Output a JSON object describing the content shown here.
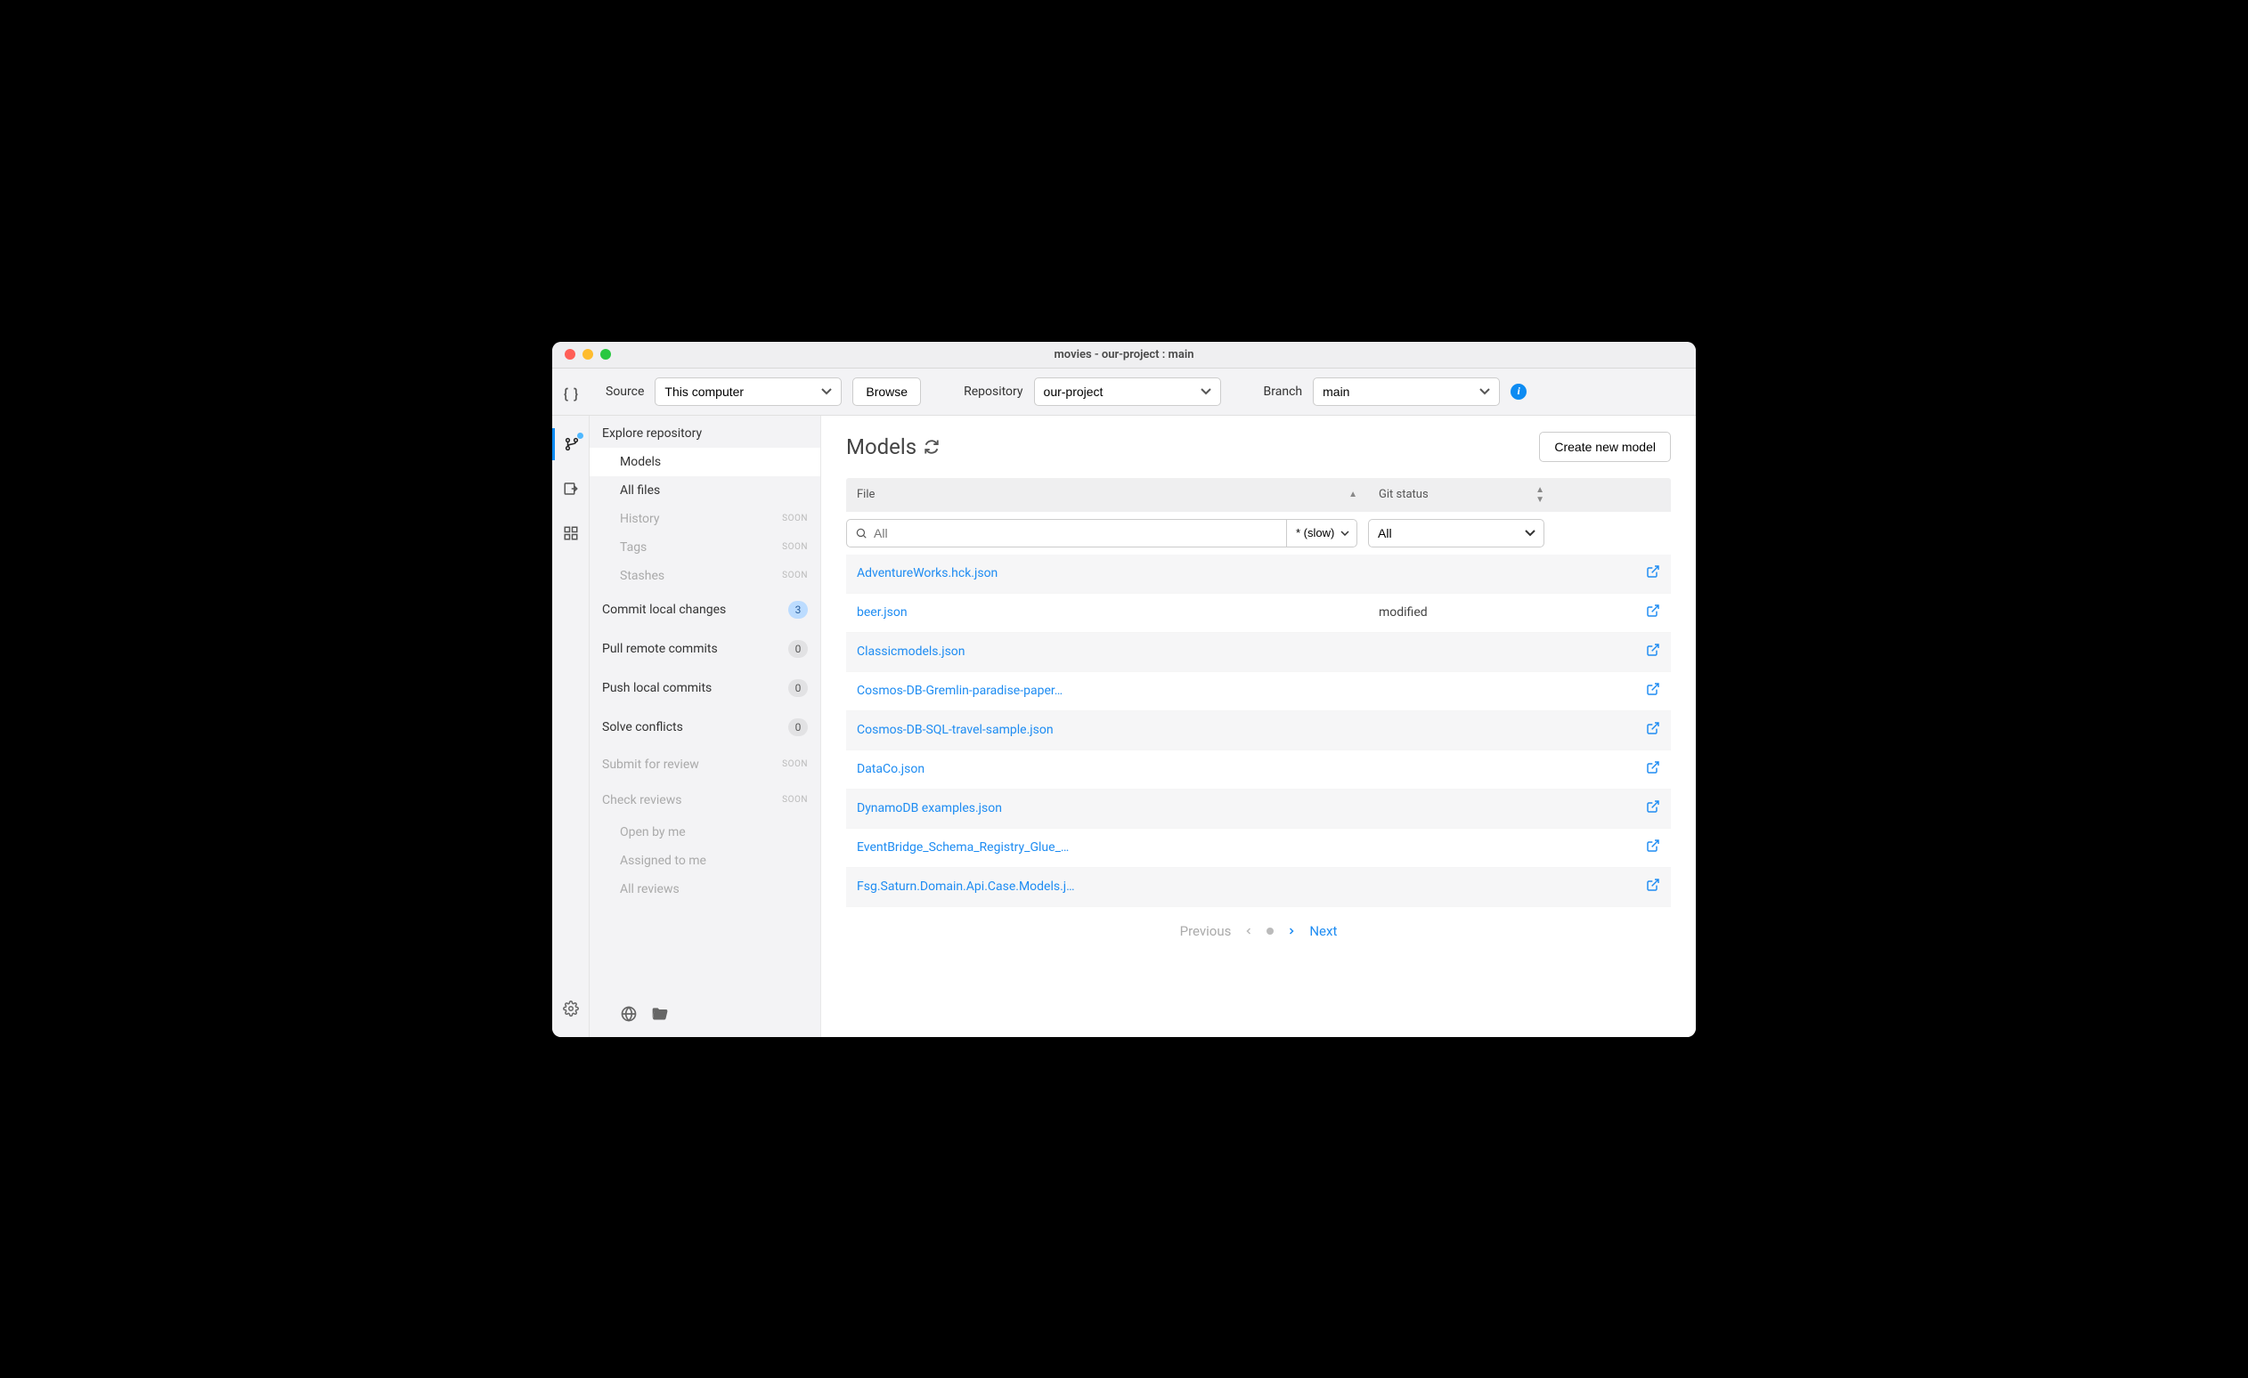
{
  "window": {
    "title": "movies - our-project : main"
  },
  "toolbar": {
    "source_label": "Source",
    "source_value": "This computer",
    "browse_label": "Browse",
    "repo_label": "Repository",
    "repo_value": "our-project",
    "branch_label": "Branch",
    "branch_value": "main"
  },
  "sidebar": {
    "explore_label": "Explore repository",
    "items": [
      {
        "label": "Models",
        "active": true
      },
      {
        "label": "All files"
      },
      {
        "label": "History",
        "soon": true
      },
      {
        "label": "Tags",
        "soon": true
      },
      {
        "label": "Stashes",
        "soon": true
      }
    ],
    "actions": [
      {
        "label": "Commit local changes",
        "count": "3",
        "blue": true
      },
      {
        "label": "Pull remote commits",
        "count": "0"
      },
      {
        "label": "Push local commits",
        "count": "0"
      },
      {
        "label": "Solve conflicts",
        "count": "0"
      },
      {
        "label": "Submit for review",
        "soon": true
      },
      {
        "label": "Check reviews",
        "soon": true
      }
    ],
    "review_sub": [
      {
        "label": "Open by me"
      },
      {
        "label": "Assigned to me"
      },
      {
        "label": "All reviews"
      }
    ],
    "soon_text": "SOON"
  },
  "main": {
    "title": "Models",
    "create_label": "Create new model",
    "columns": {
      "file": "File",
      "git": "Git status"
    },
    "search_placeholder": "All",
    "slow_label": "* (slow)",
    "git_filter_value": "All",
    "rows": [
      {
        "file": "AdventureWorks.hck.json",
        "git": ""
      },
      {
        "file": "beer.json",
        "git": "modified"
      },
      {
        "file": "Classicmodels.json",
        "git": ""
      },
      {
        "file": "Cosmos-DB-Gremlin-paradise-paper…",
        "git": ""
      },
      {
        "file": "Cosmos-DB-SQL-travel-sample.json",
        "git": ""
      },
      {
        "file": "DataCo.json",
        "git": ""
      },
      {
        "file": "DynamoDB examples.json",
        "git": ""
      },
      {
        "file": "EventBridge_Schema_Registry_Glue_…",
        "git": ""
      },
      {
        "file": "Fsg.Saturn.Domain.Api.Case.Models.j…",
        "git": ""
      }
    ],
    "pager": {
      "prev": "Previous",
      "next": "Next"
    }
  }
}
